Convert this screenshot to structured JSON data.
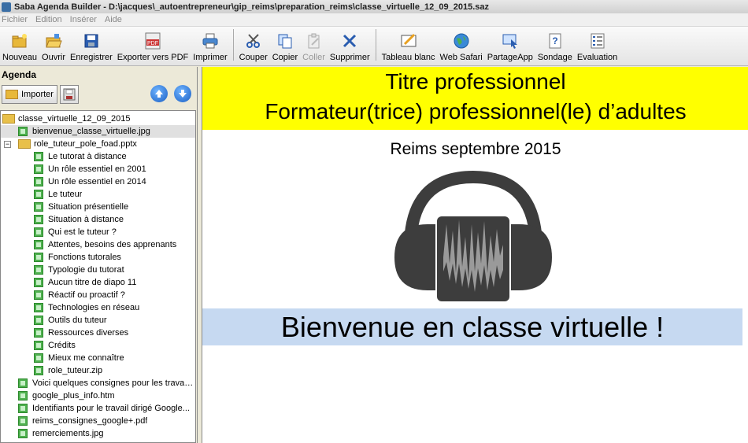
{
  "window": {
    "title": "Saba Agenda Builder - D:\\jacques\\_autoentrepreneur\\gip_reims\\preparation_reims\\classe_virtuelle_12_09_2015.saz"
  },
  "menu": [
    "Fichier",
    "Edition",
    "Insérer",
    "Aide"
  ],
  "toolbar": {
    "group1": [
      {
        "label": "Nouveau",
        "icon": "new-folder-icon"
      },
      {
        "label": "Ouvrir",
        "icon": "open-folder-icon"
      },
      {
        "label": "Enregistrer",
        "icon": "save-icon"
      },
      {
        "label": "Exporter vers PDF",
        "icon": "pdf-icon"
      },
      {
        "label": "Imprimer",
        "icon": "printer-icon"
      }
    ],
    "group2": [
      {
        "label": "Couper",
        "icon": "scissors-icon"
      },
      {
        "label": "Copier",
        "icon": "copy-icon"
      },
      {
        "label": "Coller",
        "icon": "paste-icon"
      },
      {
        "label": "Supprimer",
        "icon": "delete-icon"
      }
    ],
    "group3": [
      {
        "label": "Tableau blanc",
        "icon": "whiteboard-icon"
      },
      {
        "label": "Web Safari",
        "icon": "globe-icon"
      },
      {
        "label": "PartageApp",
        "icon": "share-app-icon"
      },
      {
        "label": "Sondage",
        "icon": "poll-icon"
      },
      {
        "label": "Evaluation",
        "icon": "evaluation-icon"
      }
    ]
  },
  "agenda": {
    "header": "Agenda",
    "import_label": "Importer",
    "root": "classe_virtuelle_12_09_2015",
    "items_top": [
      "bienvenue_classe_virtuelle.jpg"
    ],
    "pptx": "role_tuteur_pole_foad.pptx",
    "pptx_children": [
      "Le tutorat à distance",
      "Un rôle essentiel en 2001",
      "Un rôle essentiel en 2014",
      "Le tuteur",
      "Situation présentielle",
      "Situation à distance",
      "Qui est le tuteur ?",
      "Attentes, besoins des apprenants",
      "Fonctions tutorales",
      "Typologie du tutorat",
      "Aucun titre de diapo 11",
      "Réactif ou proactif ?",
      "Technologies en réseau",
      "Outils du tuteur",
      "Ressources diverses",
      "Crédits",
      "Mieux me connaître",
      "role_tuteur.zip"
    ],
    "items_bottom": [
      "Voici quelques consignes pour les travau...",
      "google_plus_info.htm",
      "Identifiants pour le travail dirigé Google...",
      "reims_consignes_google+.pdf",
      "remerciements.jpg"
    ]
  },
  "slide": {
    "title_line1": "Titre professionnel",
    "title_line2": "Formateur(trice) professionnel(le) d’adultes",
    "subtitle": "Reims septembre 2015",
    "banner": "Bienvenue en classe virtuelle !",
    "colors": {
      "yellow": "#ffff00",
      "blue": "#c6d9f1",
      "headphones": "#3d3d3d"
    }
  }
}
